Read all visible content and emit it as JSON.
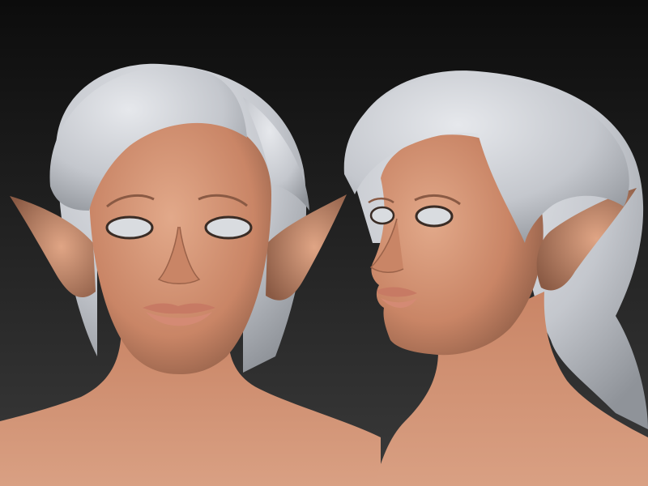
{
  "scene": {
    "views": [
      {
        "id": "front",
        "view": "front-three-quarter"
      },
      {
        "id": "side",
        "view": "side-three-quarter"
      }
    ],
    "colors": {
      "background_top": "#0c0c0c",
      "background_bottom": "#3a3a3a",
      "skin_light": "#e2a98a",
      "skin_mid": "#c98566",
      "skin_shadow": "#8a5a44",
      "hair_light": "#e6e8ec",
      "hair_mid": "#c4c7cd",
      "hair_shadow": "#8f9399",
      "eye_white": "#d9dce0",
      "eye_outline": "#3a2c25",
      "lips": "#d48a74"
    }
  }
}
